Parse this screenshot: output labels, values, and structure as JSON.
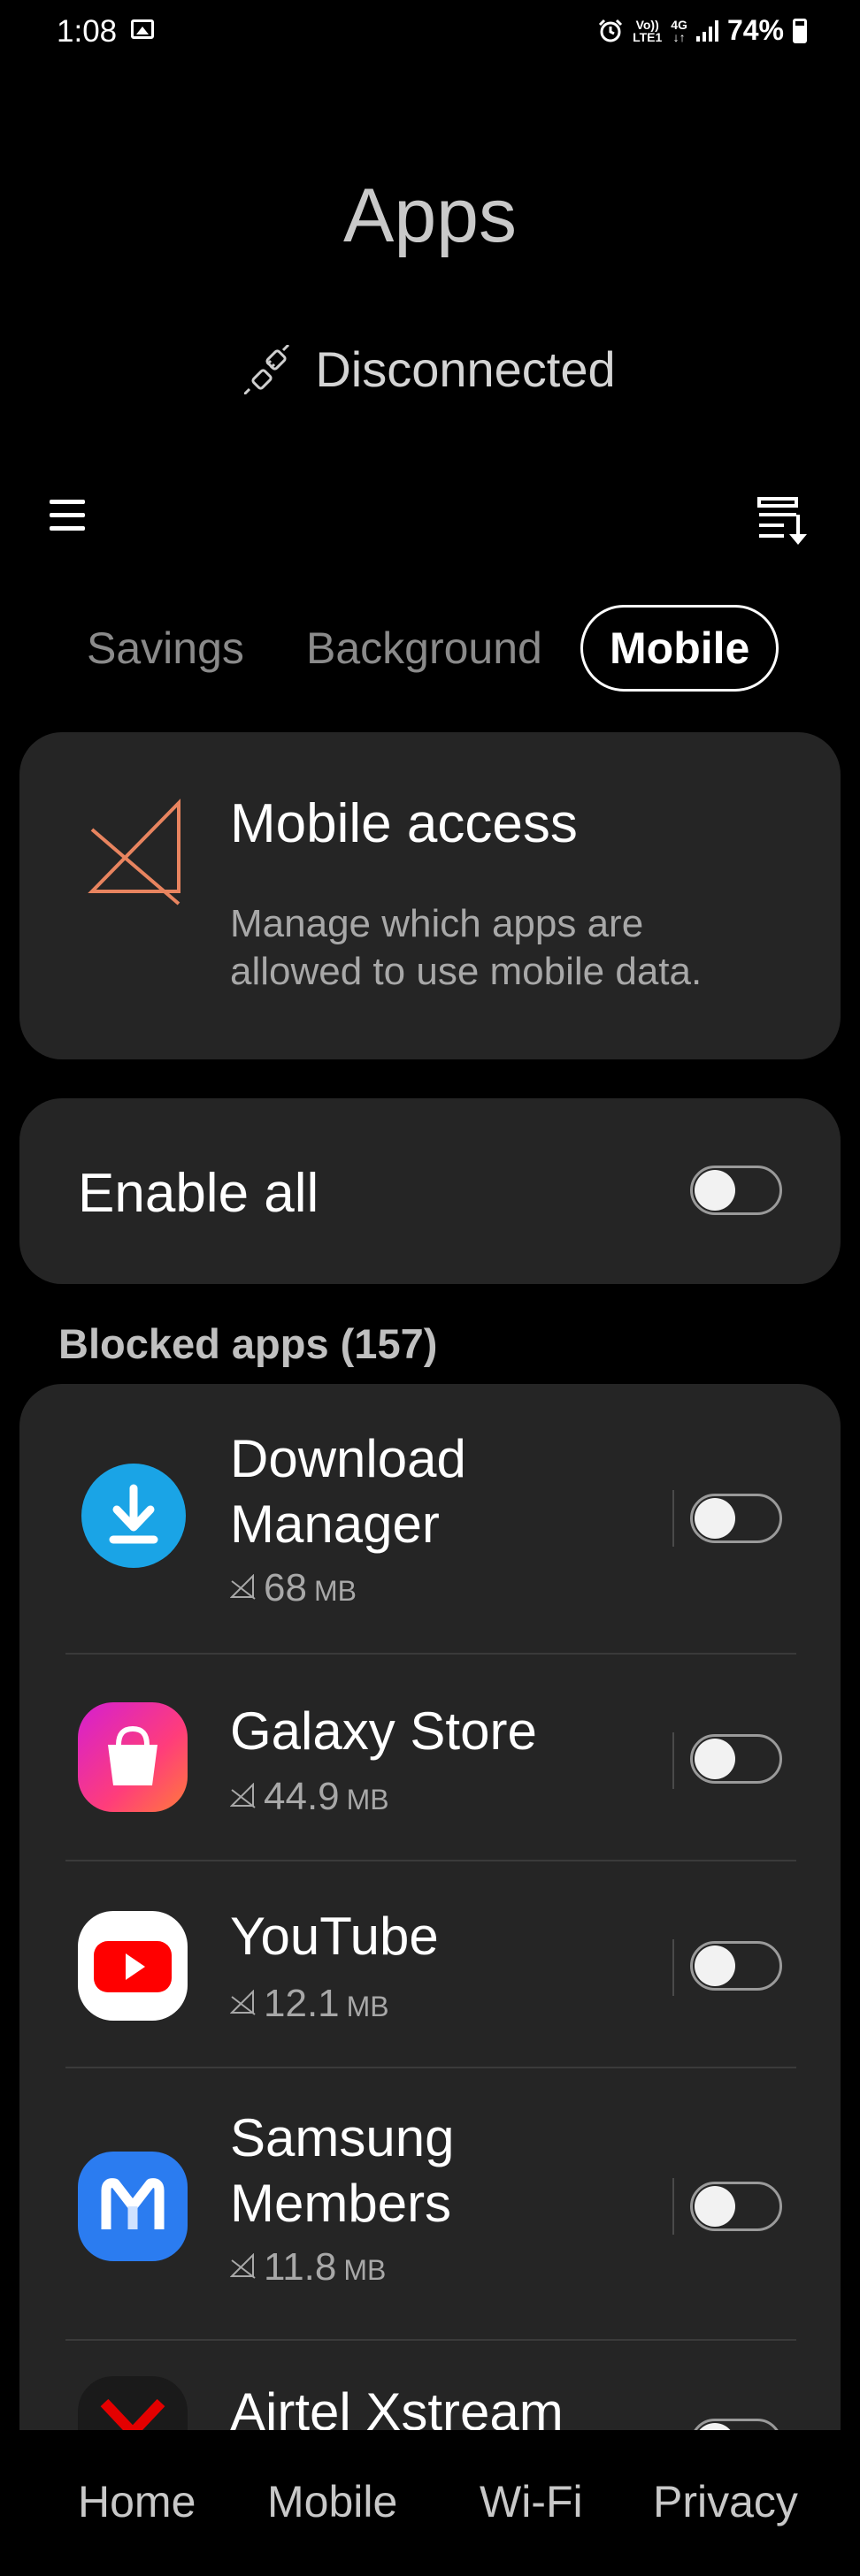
{
  "status_bar": {
    "time": "1:08",
    "volte_top": "Vo))",
    "volte_bottom": "LTE1",
    "network": "4G",
    "network_sub": "↓↑",
    "battery": "74%"
  },
  "header": {
    "title": "Apps",
    "connection_status": "Disconnected"
  },
  "tabs": [
    {
      "label": "Savings"
    },
    {
      "label": "Background"
    },
    {
      "label": "Mobile",
      "active": true
    }
  ],
  "access_card": {
    "title": "Mobile access",
    "description": "Manage which apps are allowed to use mobile data.",
    "icon": "mobile-data-off-icon",
    "icon_color": "#e8845f"
  },
  "enable_all": {
    "label": "Enable all",
    "enabled": false
  },
  "blocked_section": {
    "header": "Blocked apps (157)"
  },
  "apps": [
    {
      "name_line1": "Download",
      "name_line2": "Manager",
      "size_value": "68",
      "size_unit": "MB",
      "icon": "download-manager-icon",
      "enabled": false
    },
    {
      "name_line1": "Galaxy Store",
      "name_line2": "",
      "size_value": "44.9",
      "size_unit": "MB",
      "icon": "galaxy-store-icon",
      "enabled": false
    },
    {
      "name_line1": "YouTube",
      "name_line2": "",
      "size_value": "12.1",
      "size_unit": "MB",
      "icon": "youtube-icon",
      "enabled": false
    },
    {
      "name_line1": "Samsung",
      "name_line2": "Members",
      "size_value": "11.8",
      "size_unit": "MB",
      "icon": "samsung-members-icon",
      "enabled": false
    },
    {
      "name_line1": "Airtel Xstream",
      "name_line2": "",
      "size_value": "",
      "size_unit": "",
      "icon": "airtel-xstream-icon",
      "enabled": false
    }
  ],
  "bottom_nav": [
    {
      "label": "Home"
    },
    {
      "label": "Mobile"
    },
    {
      "label": "Wi-Fi"
    },
    {
      "label": "Privacy"
    }
  ],
  "colors": {
    "background": "#000000",
    "card": "#252525",
    "accent_orange": "#e8845f"
  }
}
